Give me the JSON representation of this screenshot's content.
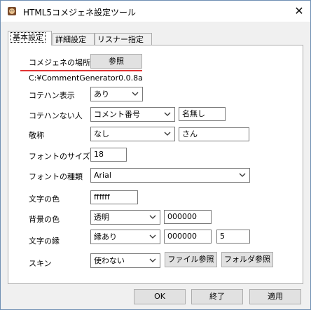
{
  "window": {
    "title": "HTML5コメジェネ設定ツール",
    "close_glyph": "✕"
  },
  "tabs": [
    {
      "label": "基本設定"
    },
    {
      "label": "詳細設定"
    },
    {
      "label": "リスナー指定"
    }
  ],
  "location": {
    "label": "コメジェネの場所",
    "browse_button": "参照",
    "path": "C:¥CommentGenerator0.0.8a"
  },
  "kotehan_display": {
    "label": "コテハン表示",
    "value": "あり"
  },
  "no_kotehan": {
    "label": "コテハンない人",
    "value": "コメント番号",
    "text": "名無し"
  },
  "honorific": {
    "label": "敬称",
    "value": "なし",
    "text": "さん"
  },
  "font_size": {
    "label": "フォントのサイズ",
    "value": "18"
  },
  "font_family": {
    "label": "フォントの種類",
    "value": "Arial"
  },
  "text_color": {
    "label": "文字の色",
    "value": "ffffff"
  },
  "bg_color": {
    "label": "背景の色",
    "mode": "透明",
    "value": "000000"
  },
  "outline": {
    "label": "文字の縁",
    "mode": "縁あり",
    "color": "000000",
    "width": "5"
  },
  "skin": {
    "label": "スキン",
    "mode": "使わない",
    "file_button": "ファイル参照",
    "folder_button": "フォルダ参照"
  },
  "footer": {
    "ok": "OK",
    "exit": "終了",
    "apply": "適用"
  },
  "colors": {
    "accent_underline": "#e23333",
    "border": "#adadad"
  }
}
